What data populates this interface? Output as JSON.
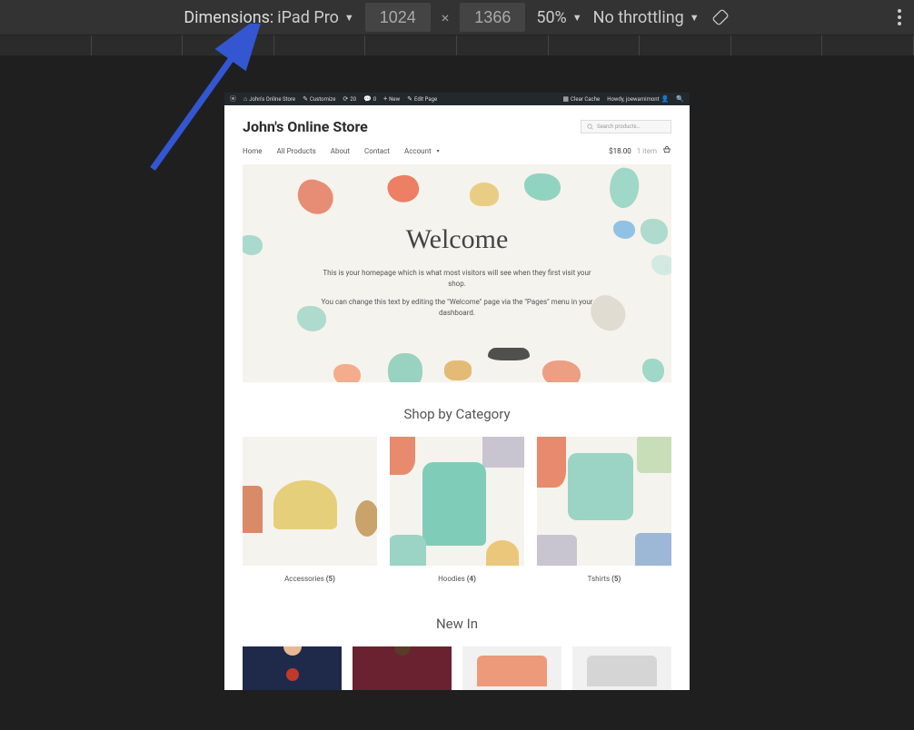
{
  "toolbar": {
    "dimensions_label": "Dimensions:",
    "device_name": "iPad Pro",
    "width_value": "1024",
    "height_value": "1366",
    "zoom": "50%",
    "throttle": "No throttling"
  },
  "wp_bar": {
    "site_name": "John's Online Store",
    "customize": "Customize",
    "updates": "20",
    "comments": "0",
    "new_label": "New",
    "edit_page": "Edit Page",
    "clear_cache": "Clear Cache",
    "howdy": "Howdy, joewarnimont"
  },
  "header": {
    "site_title": "John's Online Store",
    "search_placeholder": "Search products…"
  },
  "nav": {
    "items": [
      "Home",
      "All Products",
      "About",
      "Contact",
      "Account"
    ],
    "cart_total": "$18.00",
    "cart_count": "1 item"
  },
  "hero": {
    "title": "Welcome",
    "line1": "This is your homepage which is what most visitors will see when they first visit your shop.",
    "line2": "You can change this text by editing the \"Welcome\" page via the \"Pages\" menu in your dashboard."
  },
  "shop_by_category": {
    "title": "Shop by Category",
    "cats": [
      {
        "label": "Accessories",
        "count": "(5)"
      },
      {
        "label": "Hoodies",
        "count": "(4)"
      },
      {
        "label": "Tshirts",
        "count": "(5)"
      }
    ]
  },
  "new_in": {
    "title": "New In"
  }
}
